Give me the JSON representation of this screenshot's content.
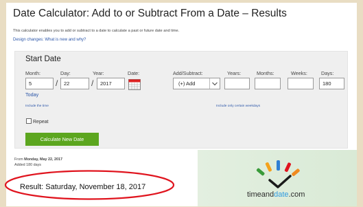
{
  "page": {
    "title": "Date Calculator: Add to or Subtract From a Date – Results",
    "description": "This calculator enables you to add or subtract to a date to calculate a past or future date and time.",
    "design_link": "Design changes: What is new and why?"
  },
  "form": {
    "heading": "Start Date",
    "labels": {
      "month": "Month:",
      "day": "Day:",
      "year": "Year:",
      "date": "Date:",
      "add_subtract": "Add/Subtract:",
      "years": "Years:",
      "months": "Months:",
      "weeks": "Weeks:",
      "days": "Days:"
    },
    "values": {
      "month": "5",
      "day": "22",
      "year": "2017",
      "add_subtract": "(+) Add",
      "years": "",
      "months": "",
      "weeks": "",
      "days": "180"
    },
    "slash": "/",
    "today_link": "Today",
    "include_time_link": "Include the time",
    "weekdays_link": "Include only certain weekdays",
    "repeat_label": "Repeat",
    "calculate_button": "Calculate New Date"
  },
  "result": {
    "from_prefix": "From ",
    "from_date": "Monday, May 22, 2017",
    "added": "Added 180 days",
    "result_text": "Result: Saturday, November 18, 2017",
    "highlight_color": "#e0141e"
  },
  "ad": {
    "brand_part1": "timeand",
    "brand_part2": "date",
    "brand_part3": ".com"
  },
  "icons": [
    "calendar-icon",
    "chevron-down-icon",
    "checkbox-icon",
    "timeanddate-logo-icon"
  ]
}
